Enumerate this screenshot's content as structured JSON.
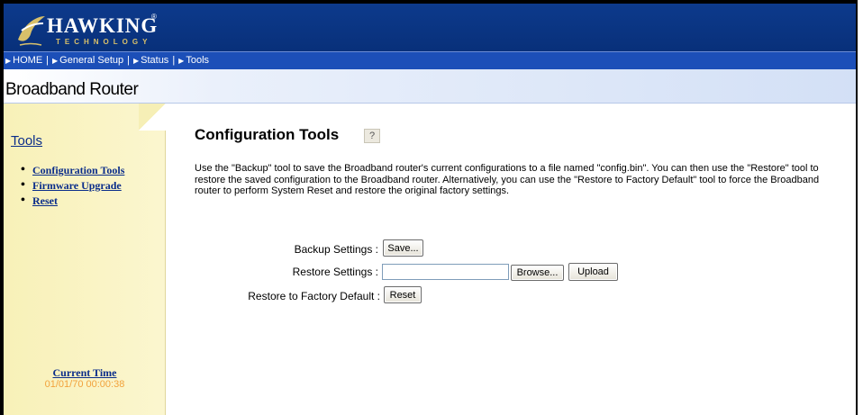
{
  "brand": {
    "name": "HAWKING",
    "sub": "TECHNOLOGY",
    "reg": "®"
  },
  "nav": {
    "items": [
      {
        "label": "HOME"
      },
      {
        "label": "General Setup"
      },
      {
        "label": "Status"
      },
      {
        "label": "Tools"
      }
    ]
  },
  "product_title": "Broadband Router",
  "sidebar": {
    "title": "Tools",
    "items": [
      {
        "label": "Configuration Tools"
      },
      {
        "label": "Firmware Upgrade"
      },
      {
        "label": "Reset"
      }
    ],
    "current_time_label": "Current Time",
    "current_time_value": "01/01/70 00:00:38"
  },
  "main": {
    "title": "Configuration Tools",
    "help_icon": "help-icon",
    "description": "Use the \"Backup\" tool to save the Broadband router's current configurations to a file named \"config.bin\". You can then use the \"Restore\" tool to restore the saved configuration to the Broadband router. Alternatively, you can use the \"Restore to Factory Default\" tool to force the Broadband router to perform System Reset and restore the original factory settings.",
    "backup_label": "Backup Settings :",
    "save_button": "Save...",
    "restore_label": "Restore Settings :",
    "restore_file_value": "",
    "browse_button": "Browse...",
    "upload_button": "Upload",
    "factory_label": "Restore to Factory Default :",
    "reset_button": "Reset"
  },
  "colors": {
    "header": "#0d3a8c",
    "nav": "#1c4fb8",
    "sidebar": "#f8f1b8",
    "link": "#0a2d8a",
    "time": "#f2a23c"
  }
}
